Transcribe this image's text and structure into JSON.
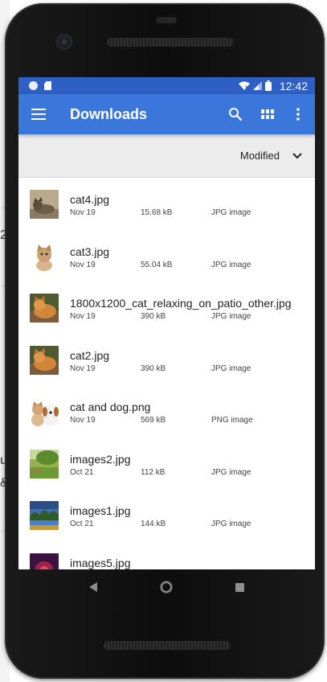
{
  "status_bar": {
    "time": "12:42"
  },
  "app_bar": {
    "title": "Downloads",
    "menu_icon": "hamburger-menu-icon",
    "search_icon": "search-icon",
    "view_icon": "grid-view-icon",
    "more_icon": "more-vert-icon"
  },
  "sort": {
    "label": "Modified",
    "icon": "chevron-down-icon"
  },
  "files": [
    {
      "name": "cat4.jpg",
      "date": "Nov 19",
      "size": "15.68 kB",
      "type": "JPG image",
      "thumb": "cat-tabby-lying"
    },
    {
      "name": "cat3.jpg",
      "date": "Nov 19",
      "size": "55.04 kB",
      "type": "JPG image",
      "thumb": "cat-kitten-sitting"
    },
    {
      "name": "1800x1200_cat_relaxing_on_patio_other.jpg",
      "date": "Nov 19",
      "size": "390 kB",
      "type": "JPG image",
      "thumb": "cat-orange-relaxing"
    },
    {
      "name": "cat2.jpg",
      "date": "Nov 19",
      "size": "390 kB",
      "type": "JPG image",
      "thumb": "cat-orange-relaxing"
    },
    {
      "name": "cat and dog.png",
      "date": "Nov 19",
      "size": "569 kB",
      "type": "PNG image",
      "thumb": "cat-and-puppy"
    },
    {
      "name": "images2.jpg",
      "date": "Oct 21",
      "size": "112 kB",
      "type": "JPG image",
      "thumb": "green-garden"
    },
    {
      "name": "images1.jpg",
      "date": "Oct 21",
      "size": "144 kB",
      "type": "JPG image",
      "thumb": "lake-trees"
    },
    {
      "name": "images5.jpg",
      "date": "",
      "size": "",
      "type": "",
      "thumb": "red-purple-abstract"
    }
  ],
  "nav_bar": {
    "back_icon": "back-icon",
    "home_icon": "home-icon",
    "recents_icon": "recents-icon"
  }
}
